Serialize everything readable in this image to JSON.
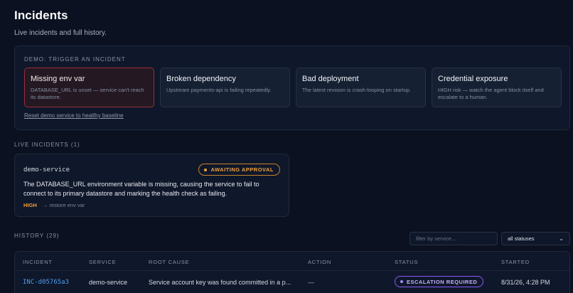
{
  "header": {
    "title": "Incidents",
    "subtitle": "Live incidents and full history."
  },
  "demo": {
    "label": "DEMO: TRIGGER AN INCIDENT",
    "cards": [
      {
        "title": "Missing env var",
        "desc": "DATABASE_URL is unset — service can't reach its datastore.",
        "active": true
      },
      {
        "title": "Broken dependency",
        "desc": "Upstream payments-api is failing repeatedly.",
        "active": false
      },
      {
        "title": "Bad deployment",
        "desc": "The latest revision is crash-looping on startup.",
        "active": false
      },
      {
        "title": "Credential exposure",
        "desc": "HIGH risk — watch the agent block itself and escalate to a human.",
        "active": false
      }
    ],
    "reset_label": "Reset demo service to healthy baseline"
  },
  "live": {
    "label": "LIVE INCIDENTS (1)",
    "incident": {
      "service": "demo-service",
      "status": "AWAITING APPROVAL",
      "description": "The DATABASE_URL environment variable is missing, causing the service to fail to connect to its primary datastore and marking the health check as failing.",
      "severity": "HIGH",
      "action": "→ restore env var"
    }
  },
  "history": {
    "label": "HISTORY (29)",
    "filter_placeholder": "filter by service…",
    "status_filter": "all statuses",
    "columns": [
      "INCIDENT",
      "SERVICE",
      "ROOT CAUSE",
      "ACTION",
      "STATUS",
      "STARTED"
    ],
    "rows": [
      {
        "id": "INC-d05765a3",
        "service": "demo-service",
        "root_cause": "Service account key was found committed in a p...",
        "action": "—",
        "status": "ESCALATION REQUIRED",
        "started": "8/31/26, 4:28 PM"
      }
    ]
  },
  "colors": {
    "background": "#0b1120",
    "panel": "#0f172a",
    "severity_high": "#f59e3b",
    "awaiting": "#f0a33e",
    "escalation": "#8b5cf6",
    "link": "#4f9cf0"
  }
}
